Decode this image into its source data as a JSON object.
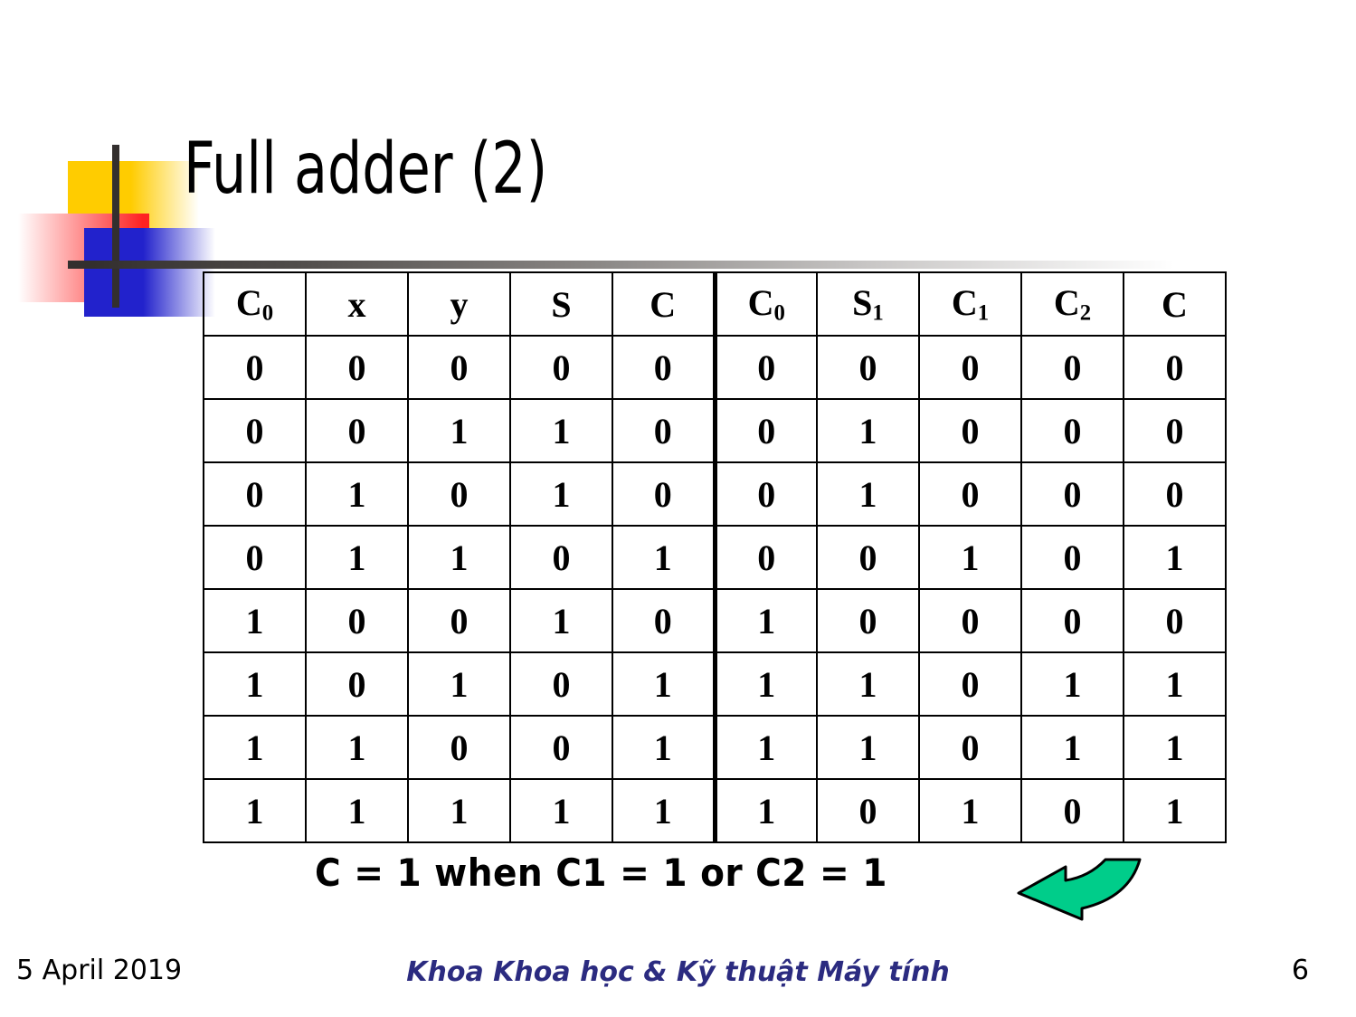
{
  "slide": {
    "title": "Full adder (2)",
    "caption": "C = 1 when C1 = 1 or C2 = 1",
    "arrow_icon": "curved-left-arrow-icon",
    "arrow_color": "#00CD8A",
    "arrow_outline": "#000000"
  },
  "logo": {
    "yellow": "#FFCC00",
    "red": "#FF2222",
    "blue": "#2222CC",
    "bar": "#332F2E"
  },
  "table": {
    "headers": [
      {
        "base": "C",
        "sub": "0"
      },
      {
        "base": "x",
        "sub": ""
      },
      {
        "base": "y",
        "sub": ""
      },
      {
        "base": "S",
        "sub": ""
      },
      {
        "base": "C",
        "sub": ""
      },
      {
        "base": "C",
        "sub": "0"
      },
      {
        "base": "S",
        "sub": "1"
      },
      {
        "base": "C",
        "sub": "1"
      },
      {
        "base": "C",
        "sub": "2"
      },
      {
        "base": "C",
        "sub": ""
      }
    ],
    "split_after_column": 5,
    "rows": [
      [
        "0",
        "0",
        "0",
        "0",
        "0",
        "0",
        "0",
        "0",
        "0",
        "0"
      ],
      [
        "0",
        "0",
        "1",
        "1",
        "0",
        "0",
        "1",
        "0",
        "0",
        "0"
      ],
      [
        "0",
        "1",
        "0",
        "1",
        "0",
        "0",
        "1",
        "0",
        "0",
        "0"
      ],
      [
        "0",
        "1",
        "1",
        "0",
        "1",
        "0",
        "0",
        "1",
        "0",
        "1"
      ],
      [
        "1",
        "0",
        "0",
        "1",
        "0",
        "1",
        "0",
        "0",
        "0",
        "0"
      ],
      [
        "1",
        "0",
        "1",
        "0",
        "1",
        "1",
        "1",
        "0",
        "1",
        "1"
      ],
      [
        "1",
        "1",
        "0",
        "0",
        "1",
        "1",
        "1",
        "0",
        "1",
        "1"
      ],
      [
        "1",
        "1",
        "1",
        "1",
        "1",
        "1",
        "0",
        "1",
        "0",
        "1"
      ]
    ]
  },
  "footer": {
    "date": "5 April 2019",
    "department": "Khoa Khoa học & Kỹ thuật Máy tính",
    "page_number": "6",
    "department_color": "#2B2B80"
  }
}
